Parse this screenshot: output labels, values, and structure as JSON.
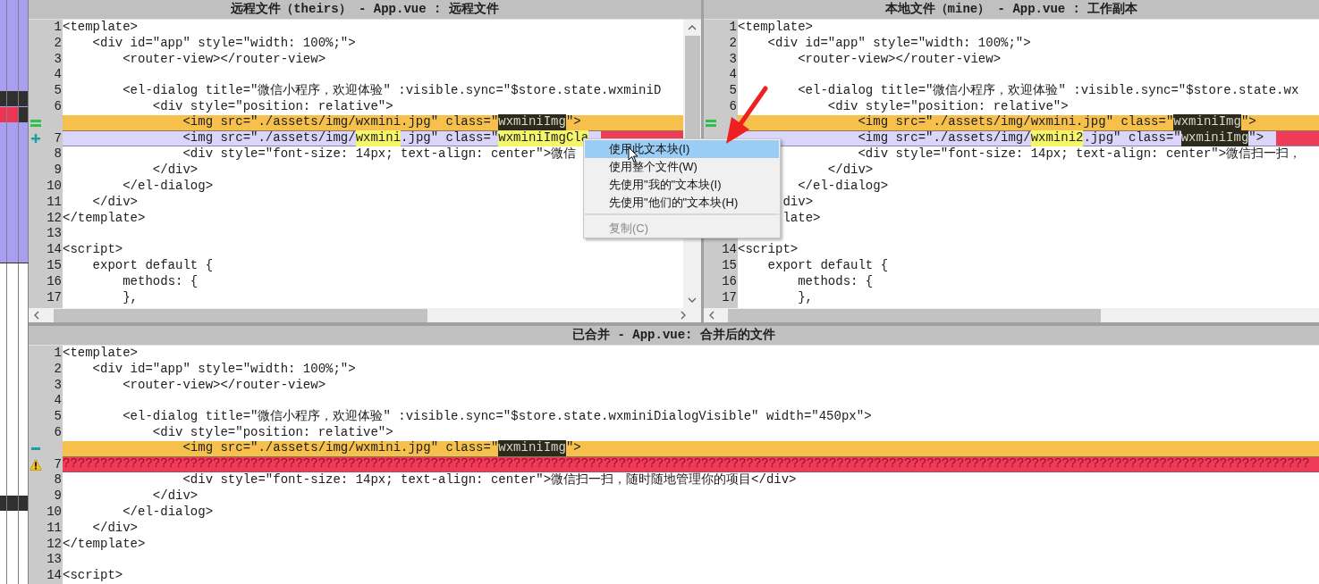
{
  "panes": [
    {
      "kind": "theirs",
      "title": "远程文件（theirs） - App.vue : 远程文件",
      "lines": [
        {
          "number": "1",
          "kind": "plain",
          "segments": [
            {
              "kind": "plain",
              "text": "<template>"
            }
          ]
        },
        {
          "number": "2",
          "kind": "plain",
          "segments": [
            {
              "kind": "plain",
              "text": "    <div id=\"app\" style=\"width: 100%;\">"
            }
          ]
        },
        {
          "number": "3",
          "kind": "plain",
          "segments": [
            {
              "kind": "plain",
              "text": "        <router-view></router-view>"
            }
          ]
        },
        {
          "number": "4",
          "kind": "plain"
        },
        {
          "number": "5",
          "kind": "plain",
          "segments": [
            {
              "kind": "plain",
              "text": "        <el-dialog title=\"微信小程序，欢迎体验\" :visible.sync=\"$store.state.wxminiD"
            }
          ]
        },
        {
          "number": "6",
          "kind": "plain",
          "segments": [
            {
              "kind": "plain",
              "text": "            <div style=\"position: relative\">"
            }
          ]
        },
        {
          "marker": {
            "kind": "equals"
          },
          "kind": "conflict",
          "segments": [
            {
              "kind": "plain",
              "text": "                <img src=\"./assets/img/wxmini.jpg\" class=\""
            },
            {
              "kind": "match",
              "text": "wxminiImg"
            },
            {
              "kind": "plain",
              "text": "\">"
            }
          ]
        },
        {
          "number": "7",
          "marker": {
            "kind": "plus"
          },
          "kind": "change",
          "trailing_conflict": true,
          "segments": [
            {
              "kind": "plain",
              "text": "                <img src=\"./assets/img/"
            },
            {
              "kind": "changed",
              "text": "wxmini"
            },
            {
              "kind": "plain",
              "text": ".jpg\" class=\""
            },
            {
              "kind": "changed",
              "text": "wxminiImgCla"
            }
          ]
        },
        {
          "number": "8",
          "kind": "plain",
          "segments": [
            {
              "kind": "plain",
              "text": "                <div style=\"font-size: 14px; text-align: center\">微信"
            }
          ]
        },
        {
          "number": "9",
          "kind": "plain",
          "segments": [
            {
              "kind": "plain",
              "text": "            </div>"
            }
          ]
        },
        {
          "number": "10",
          "kind": "plain",
          "segments": [
            {
              "kind": "plain",
              "text": "        </el-dialog>"
            }
          ]
        },
        {
          "number": "11",
          "kind": "plain",
          "segments": [
            {
              "kind": "plain",
              "text": "    </div>"
            }
          ]
        },
        {
          "number": "12",
          "kind": "plain",
          "segments": [
            {
              "kind": "plain",
              "text": "</template>"
            }
          ]
        },
        {
          "number": "13",
          "kind": "plain"
        },
        {
          "number": "14",
          "kind": "plain",
          "segments": [
            {
              "kind": "plain",
              "text": "<script>"
            }
          ]
        },
        {
          "number": "15",
          "kind": "plain",
          "segments": [
            {
              "kind": "plain",
              "text": "    export default {"
            }
          ]
        },
        {
          "number": "16",
          "kind": "plain",
          "segments": [
            {
              "kind": "plain",
              "text": "        methods: {"
            }
          ]
        },
        {
          "number": "17",
          "kind": "plain",
          "segments": [
            {
              "kind": "plain",
              "text": "        },"
            }
          ]
        }
      ]
    },
    {
      "kind": "mine",
      "title": "本地文件（mine） - App.vue : 工作副本",
      "lines": [
        {
          "number": "1",
          "kind": "plain",
          "segments": [
            {
              "kind": "plain",
              "text": "<template>"
            }
          ]
        },
        {
          "number": "2",
          "kind": "plain",
          "segments": [
            {
              "kind": "plain",
              "text": "    <div id=\"app\" style=\"width: 100%;\">"
            }
          ]
        },
        {
          "number": "3",
          "kind": "plain",
          "segments": [
            {
              "kind": "plain",
              "text": "        <router-view></router-view>"
            }
          ]
        },
        {
          "number": "4",
          "kind": "plain"
        },
        {
          "number": "5",
          "kind": "plain",
          "segments": [
            {
              "kind": "plain",
              "text": "        <el-dialog title=\"微信小程序，欢迎体验\" :visible.sync=\"$store.state.wx"
            }
          ]
        },
        {
          "number": "6",
          "kind": "plain",
          "segments": [
            {
              "kind": "plain",
              "text": "            <div style=\"position: relative\">"
            }
          ]
        },
        {
          "marker": {
            "kind": "equals"
          },
          "kind": "conflict",
          "segments": [
            {
              "kind": "plain",
              "text": "                <img src=\"./assets/img/wxmini.jpg\" class=\""
            },
            {
              "kind": "match",
              "text": "wxminiImg"
            },
            {
              "kind": "plain",
              "text": "\">"
            }
          ]
        },
        {
          "kind": "change",
          "trailing_conflict": true,
          "segments": [
            {
              "kind": "plain",
              "text": "                <img src=\"./assets/img/"
            },
            {
              "kind": "changed",
              "text": "wxmini2"
            },
            {
              "kind": "plain",
              "text": ".jpg\" class=\""
            },
            {
              "kind": "match",
              "text": "wxminiImg"
            },
            {
              "kind": "plain",
              "text": "\">"
            }
          ]
        },
        {
          "kind": "plain",
          "segments": [
            {
              "kind": "plain",
              "text": "                <div style=\"font-size: 14px; text-align: center\">微信扫一扫，"
            }
          ]
        },
        {
          "kind": "plain",
          "segments": [
            {
              "kind": "plain",
              "text": "            </div>"
            }
          ]
        },
        {
          "kind": "plain",
          "segments": [
            {
              "kind": "plain",
              "text": "        </el-dialog>"
            }
          ]
        },
        {
          "kind": "plain",
          "segments": [
            {
              "kind": "plain",
              "text": "      div>"
            }
          ]
        },
        {
          "kind": "plain",
          "segments": [
            {
              "kind": "plain",
              "text": "      late>"
            }
          ]
        },
        {
          "kind": "plain"
        },
        {
          "number": "14",
          "kind": "plain",
          "segments": [
            {
              "kind": "plain",
              "text": "<script>"
            }
          ]
        },
        {
          "number": "15",
          "kind": "plain",
          "segments": [
            {
              "kind": "plain",
              "text": "    export default {"
            }
          ]
        },
        {
          "number": "16",
          "kind": "plain",
          "segments": [
            {
              "kind": "plain",
              "text": "        methods: {"
            }
          ]
        },
        {
          "number": "17",
          "kind": "plain",
          "segments": [
            {
              "kind": "plain",
              "text": "        },"
            }
          ]
        }
      ]
    },
    {
      "kind": "merged",
      "title": "已合并 - App.vue: 合并后的文件",
      "lines": [
        {
          "number": "1",
          "kind": "plain",
          "segments": [
            {
              "kind": "plain",
              "text": "<template>"
            }
          ]
        },
        {
          "number": "2",
          "kind": "plain",
          "segments": [
            {
              "kind": "plain",
              "text": "    <div id=\"app\" style=\"width: 100%;\">"
            }
          ]
        },
        {
          "number": "3",
          "kind": "plain",
          "segments": [
            {
              "kind": "plain",
              "text": "        <router-view></router-view>"
            }
          ]
        },
        {
          "number": "4",
          "kind": "plain"
        },
        {
          "number": "5",
          "kind": "plain",
          "segments": [
            {
              "kind": "plain",
              "text": "        <el-dialog title=\"微信小程序，欢迎体验\" :visible.sync=\"$store.state.wxminiDialogVisible\" width=\"450px\">"
            }
          ]
        },
        {
          "number": "6",
          "kind": "plain",
          "segments": [
            {
              "kind": "plain",
              "text": "            <div style=\"position: relative\">"
            }
          ]
        },
        {
          "marker": {
            "kind": "minus"
          },
          "kind": "conflict",
          "segments": [
            {
              "kind": "plain",
              "text": "                <img src=\"./assets/img/wxmini.jpg\" class=\""
            },
            {
              "kind": "match",
              "text": "wxminiImg"
            },
            {
              "kind": "plain",
              "text": "\">"
            }
          ]
        },
        {
          "number": "7",
          "marker": {
            "kind": "warning"
          },
          "kind": "unresolved",
          "segments": [
            {
              "kind": "plain",
              "text": "??????????????????????????????????????????????????????????????????????????????????????????????????????????????????????????????????????????????????????????????????????"
            }
          ]
        },
        {
          "number": "8",
          "kind": "plain",
          "segments": [
            {
              "kind": "plain",
              "text": "                <div style=\"font-size: 14px; text-align: center\">微信扫一扫，随时随地管理你的项目</div>"
            }
          ]
        },
        {
          "number": "9",
          "kind": "plain",
          "segments": [
            {
              "kind": "plain",
              "text": "            </div>"
            }
          ]
        },
        {
          "number": "10",
          "kind": "plain",
          "segments": [
            {
              "kind": "plain",
              "text": "        </el-dialog>"
            }
          ]
        },
        {
          "number": "11",
          "kind": "plain",
          "segments": [
            {
              "kind": "plain",
              "text": "    </div>"
            }
          ]
        },
        {
          "number": "12",
          "kind": "plain",
          "segments": [
            {
              "kind": "plain",
              "text": "</template>"
            }
          ]
        },
        {
          "number": "13",
          "kind": "plain"
        },
        {
          "number": "14",
          "kind": "plain",
          "segments": [
            {
              "kind": "plain",
              "text": "<script>"
            }
          ]
        }
      ]
    }
  ],
  "context_menu": {
    "items": [
      {
        "label": "使用此文本块(I)",
        "selected": true,
        "disabled": false,
        "separator_before": false
      },
      {
        "label": "使用整个文件(W)",
        "selected": false,
        "disabled": false,
        "separator_before": false
      },
      {
        "label": "先使用\"我的\"文本块(I)",
        "selected": false,
        "disabled": false,
        "separator_before": false
      },
      {
        "label": "先使用\"他们的\"文本块(H)",
        "selected": false,
        "disabled": false,
        "separator_before": false
      },
      {
        "label": "复制(C)",
        "selected": false,
        "disabled": true,
        "separator_before": true
      }
    ]
  }
}
